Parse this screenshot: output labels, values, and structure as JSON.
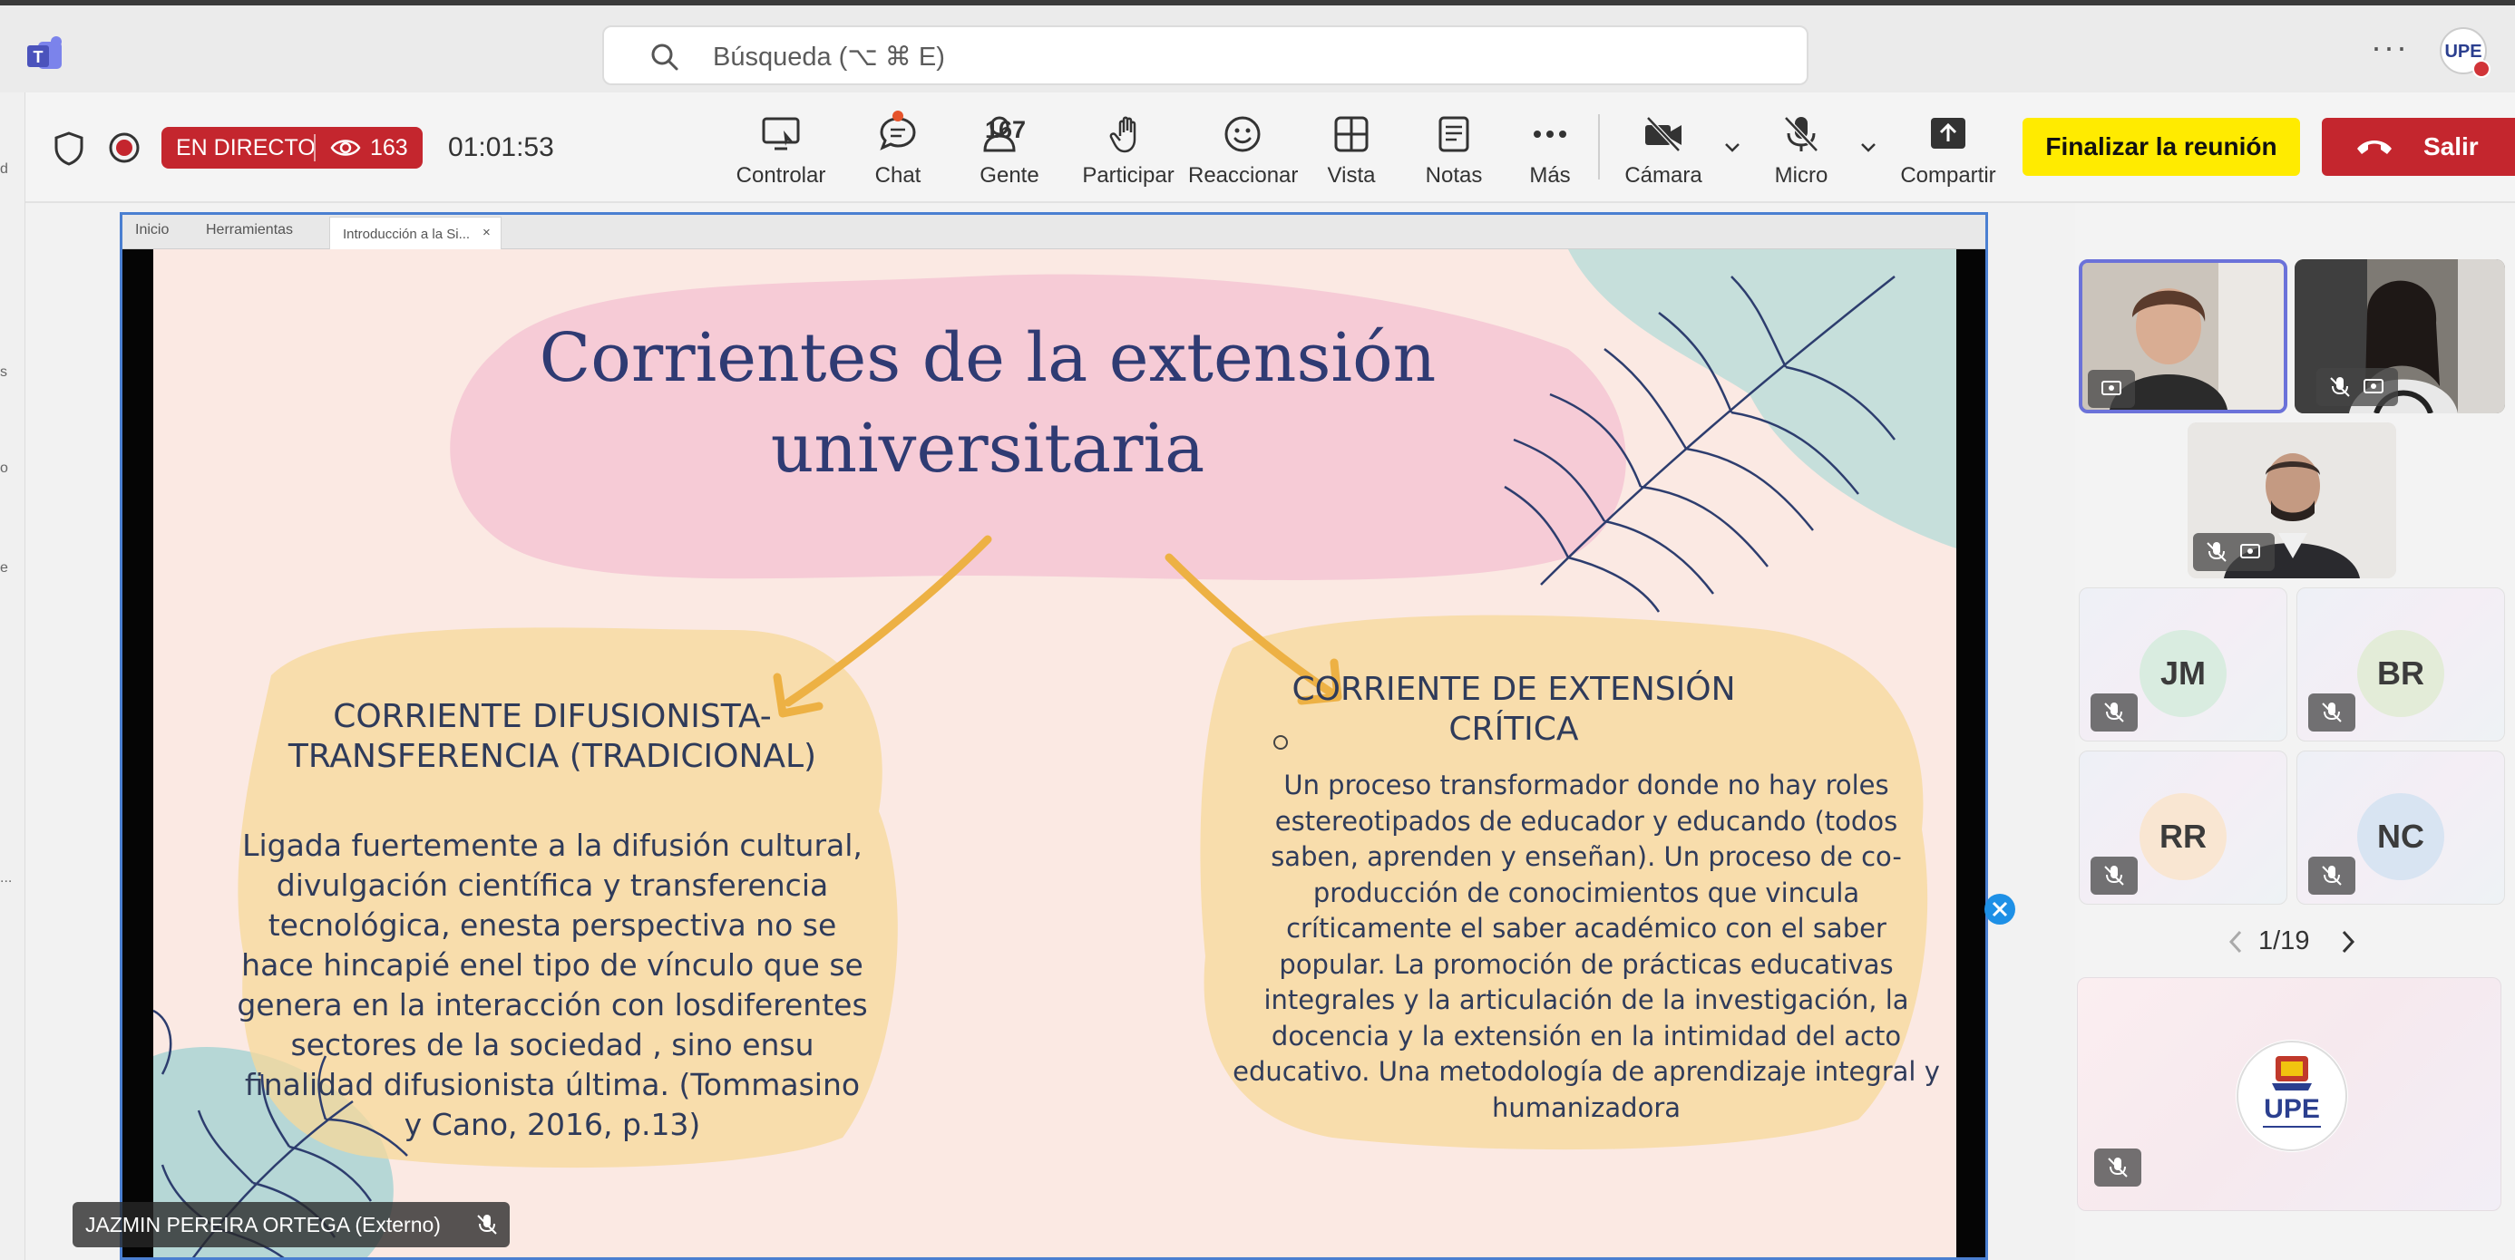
{
  "titlebar": {
    "app_icon": "teams-icon",
    "search_placeholder": "Búsqueda (⌥ ⌘ E)",
    "more_icon": "more-icon",
    "account_initials": "UPE"
  },
  "leftrail": {
    "fragments": [
      "d",
      "s",
      "o",
      "e",
      "..."
    ]
  },
  "toolbar": {
    "live_label": "EN DIRECTO",
    "viewers": "163",
    "elapsed": "01:01:53",
    "buttons": {
      "control": "Controlar",
      "chat": "Chat",
      "people": "Gente",
      "people_count": "167",
      "raise": "Participar",
      "react": "Reaccionar",
      "view": "Vista",
      "notes": "Notas",
      "more": "Más",
      "camera": "Cámara",
      "mic": "Micro",
      "share": "Compartir"
    },
    "end_meeting": "Finalizar la reunión",
    "leave": "Salir",
    "colors": {
      "live": "#c4262e",
      "end_meeting": "#ffeb00",
      "leave": "#c4262e"
    }
  },
  "shared_screen": {
    "browser_tabs": [
      "Inicio",
      "Herramientas"
    ],
    "active_tab": "Introducción a la Si...",
    "active_tab_close": "×",
    "slide": {
      "title": "Corrientes de la extensión universitaria",
      "left_heading": "CORRIENTE DIFUSIONISTA- TRANSFERENCIA (TRADICIONAL)",
      "left_body": "Ligada fuertemente a la difusión cultural, divulgación científica y transferencia tecnológica, enesta perspectiva no se hace hincapié enel tipo de vínculo que se genera en la interacción con losdiferentes sectores de la sociedad , sino ensu finalidad difusionista última. (Tommasino y Cano, 2016, p.13)",
      "right_heading": "CORRIENTE DE EXTENSIÓN CRÍTICA",
      "right_body": "Un proceso transformador donde no hay roles estereotipados de educador y educando (todos saben, aprenden y enseñan). Un proceso de co-producción de conocimientos que vincula críticamente el saber académico con el saber popular. La promoción de prácticas educativas integrales y la articulación de la investigación, la docencia y la extensión en la intimidad del acto educativo. Una metodología de aprendizaje integral y humanizadora"
    },
    "presenter_name": "JAZMIN PEREIRA ORTEGA (Externo)"
  },
  "participants": {
    "avatars": [
      {
        "initials": "JM",
        "color": "#d9ece0"
      },
      {
        "initials": "BR",
        "color": "#e3ecd8"
      },
      {
        "initials": "RR",
        "color": "#f9e6d2"
      },
      {
        "initials": "NC",
        "color": "#d8e4f2"
      }
    ],
    "pager": "1/19",
    "logo_text": "UPE"
  }
}
